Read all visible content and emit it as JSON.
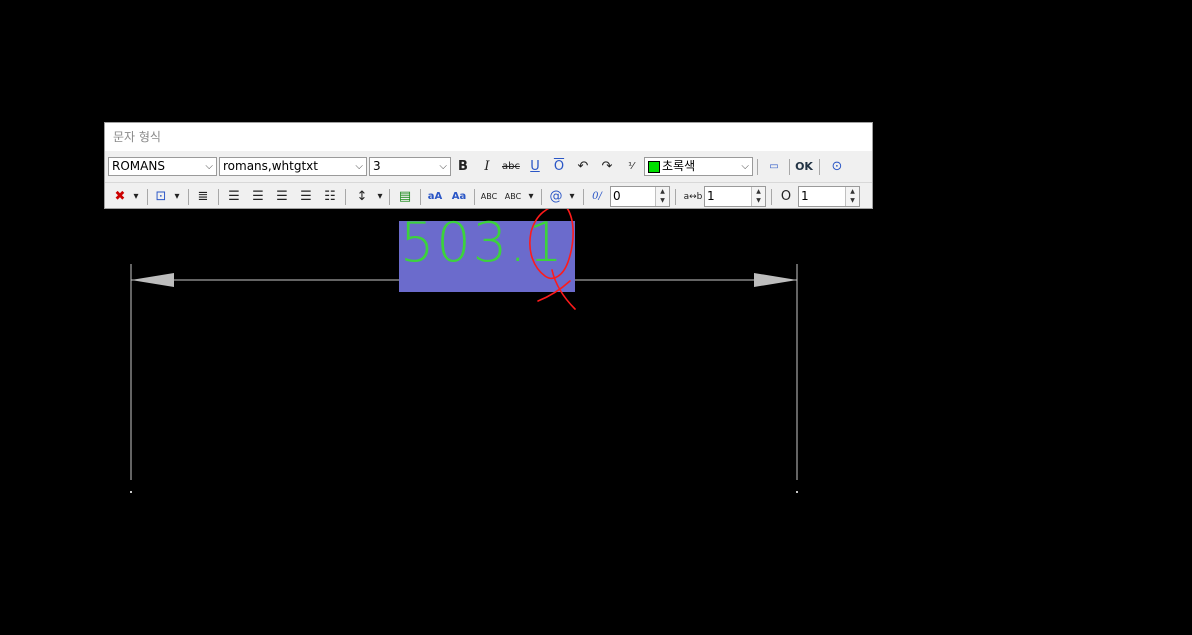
{
  "toolbar": {
    "title": "문자 형식",
    "style_value": "ROMANS",
    "font_value": "romans,whtgtxt",
    "height_value": "3",
    "color_value": "초록색",
    "bold_label": "B",
    "italic_label": "I",
    "strike_label": "abc",
    "underline_label": "U",
    "overline_label": "O",
    "ok_label": "OK",
    "symbol_label": "@",
    "oblique_label": "0/",
    "oblique_value": "0",
    "tracking_label": "a↔b",
    "tracking_value": "1",
    "width_label": "O",
    "width_value": "1",
    "upper_label": "aA",
    "lower_label": "Aa",
    "spell_label": "ABC"
  },
  "drawing": {
    "dimension_text": "503.1",
    "colors": {
      "text": "#3cd33c",
      "selection": "#6b6bcc",
      "annotation": "#ff0000",
      "lines": "#c0c0c0"
    }
  }
}
